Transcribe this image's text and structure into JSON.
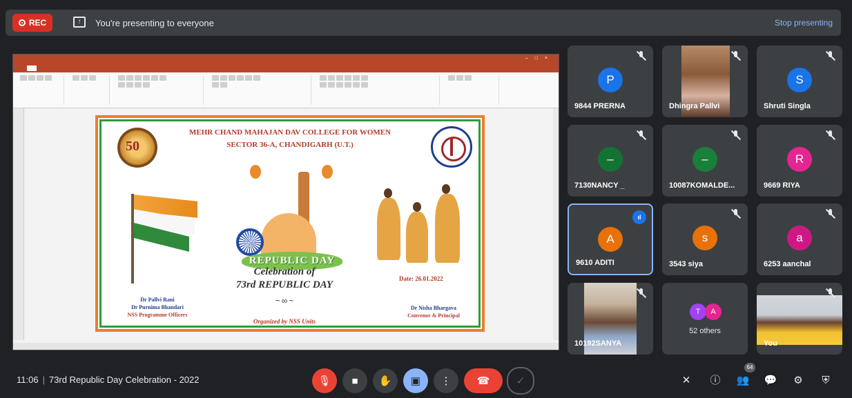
{
  "topbar": {
    "rec_label": "REC",
    "presenting_text": "You're presenting to everyone",
    "stop_label": "Stop presenting"
  },
  "slide": {
    "college_line1": "MEHR CHAND MAHAJAN DAV COLLEGE FOR WOMEN",
    "college_line2": "SECTOR 36-A, CHANDIGARH (U.T.)",
    "banner": "REPUBLIC DAY",
    "celebration_line1": "Celebration of",
    "celebration_line2": "73rd REPUBLIC DAY",
    "date": "Date: 26.01.2022",
    "officer1": "Dr Pallvi Rani",
    "officer2": "Dr Purnima Bhandari",
    "officer_role": "NSS Programme Officers",
    "organized": "Organized by NSS Units",
    "principal_name": "Dr Nisha Bhargava",
    "principal_role": "Convenor & Principal"
  },
  "participants": [
    {
      "name": "9844 PRERNA",
      "initial": "P",
      "color": "#1a73e8"
    },
    {
      "name": "Dhingra Pallvi",
      "initial": "",
      "color": ""
    },
    {
      "name": "Shruti Singla",
      "initial": "S",
      "color": "#1a73e8"
    },
    {
      "name": "7130NANCY _",
      "initial": "–",
      "color": "#137333"
    },
    {
      "name": "10087KOMALDE...",
      "initial": "–",
      "color": "#188038"
    },
    {
      "name": "9669 RIYA",
      "initial": "R",
      "color": "#e52592"
    },
    {
      "name": "9610 ADITI",
      "initial": "A",
      "color": "#e8710a"
    },
    {
      "name": "3543 siya",
      "initial": "s",
      "color": "#e8710a"
    },
    {
      "name": "6253 aanchal",
      "initial": "a",
      "color": "#d01884"
    },
    {
      "name": "10192SANYA",
      "initial": "",
      "color": ""
    },
    {
      "name": "52 others",
      "initial": "",
      "color": ""
    },
    {
      "name": "You",
      "initial": "",
      "color": ""
    }
  ],
  "others": {
    "a1": "T",
    "a1_color": "#a142f4",
    "a2": "A",
    "a2_color": "#e52592",
    "label": "52 others"
  },
  "bottombar": {
    "time": "11:06",
    "meeting_title": "73rd Republic Day Celebration - 2022",
    "participants_count": "64"
  }
}
